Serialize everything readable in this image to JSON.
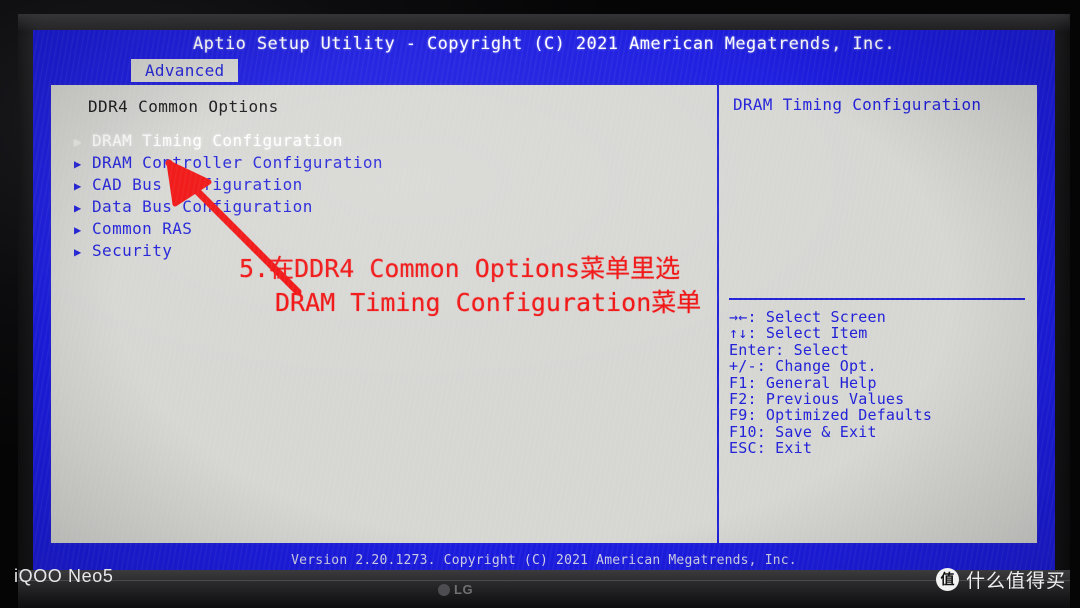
{
  "bios": {
    "title": "Aptio Setup Utility - Copyright (C) 2021 American Megatrends, Inc.",
    "tab": "Advanced",
    "section_heading": "DDR4 Common Options",
    "menu_items": [
      {
        "label": "DRAM Timing Configuration",
        "arrow": "triangle-right-icon",
        "selected": true
      },
      {
        "label": "DRAM Controller Configuration",
        "arrow": "triangle-right-icon",
        "selected": false
      },
      {
        "label": "CAD Bus Configuration",
        "arrow": "triangle-right-icon",
        "selected": false
      },
      {
        "label": "Data Bus Configuration",
        "arrow": "triangle-right-icon",
        "selected": false
      },
      {
        "label": "Common RAS",
        "arrow": "triangle-right-icon",
        "selected": false
      },
      {
        "label": "Security",
        "arrow": "triangle-right-icon",
        "selected": false
      }
    ],
    "help_title": "DRAM Timing Configuration",
    "help_keys": [
      "→←: Select Screen",
      "↑↓: Select Item",
      "Enter: Select",
      "+/-: Change Opt.",
      "F1: General Help",
      "F2: Previous Values",
      "F9: Optimized Defaults",
      "F10: Save & Exit",
      "ESC: Exit"
    ],
    "footer": "Version 2.20.1273. Copyright (C) 2021 American Megatrends, Inc."
  },
  "annotation": {
    "line1": "5.在DDR4 Common Options菜单里选",
    "line2": "DRAM Timing Configuration菜单",
    "color": "#f01010",
    "arrow_from": "280,278",
    "arrow_to": "150,146"
  },
  "monitor": {
    "brand": "LG"
  },
  "watermarks": {
    "left": "iQOO Neo5",
    "badge": "值",
    "right": "什么值得买"
  },
  "colors": {
    "bios_blue": "#1c1ce0",
    "panel_bg": "#d6d6d3",
    "text_blue": "#2020d8",
    "annotation_red": "#f01010"
  }
}
